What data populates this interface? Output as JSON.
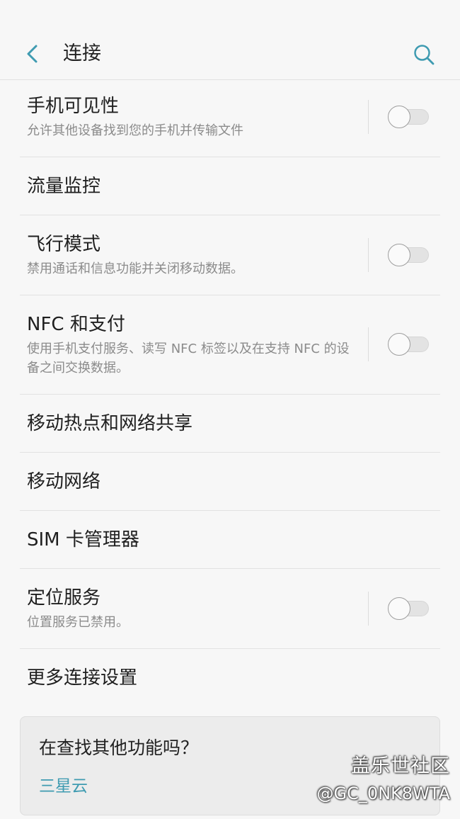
{
  "header": {
    "title": "连接",
    "back_icon": "chevron-left-icon",
    "search_icon": "search-icon",
    "accent_color": "#3f9bb1"
  },
  "settings": [
    {
      "title": "手机可见性",
      "subtitle": "允许其他设备找到您的手机并传输文件",
      "toggle": "off"
    },
    {
      "title": "流量监控"
    },
    {
      "title": "飞行模式",
      "subtitle": "禁用通话和信息功能并关闭移动数据。",
      "toggle": "off"
    },
    {
      "title": "NFC 和支付",
      "subtitle": "使用手机支付服务、读写 NFC 标签以及在支持 NFC 的设备之间交换数据。",
      "toggle": "off"
    },
    {
      "title": "移动热点和网络共享"
    },
    {
      "title": "移动网络"
    },
    {
      "title": "SIM 卡管理器"
    },
    {
      "title": "定位服务",
      "subtitle": "位置服务已禁用。",
      "toggle": "off"
    },
    {
      "title": "更多连接设置"
    }
  ],
  "suggestion_card": {
    "title": "在查找其他功能吗？",
    "link": "三星云"
  },
  "watermark": {
    "line1": "盖乐世社区",
    "line2": "@GC_0NK8WTA"
  }
}
